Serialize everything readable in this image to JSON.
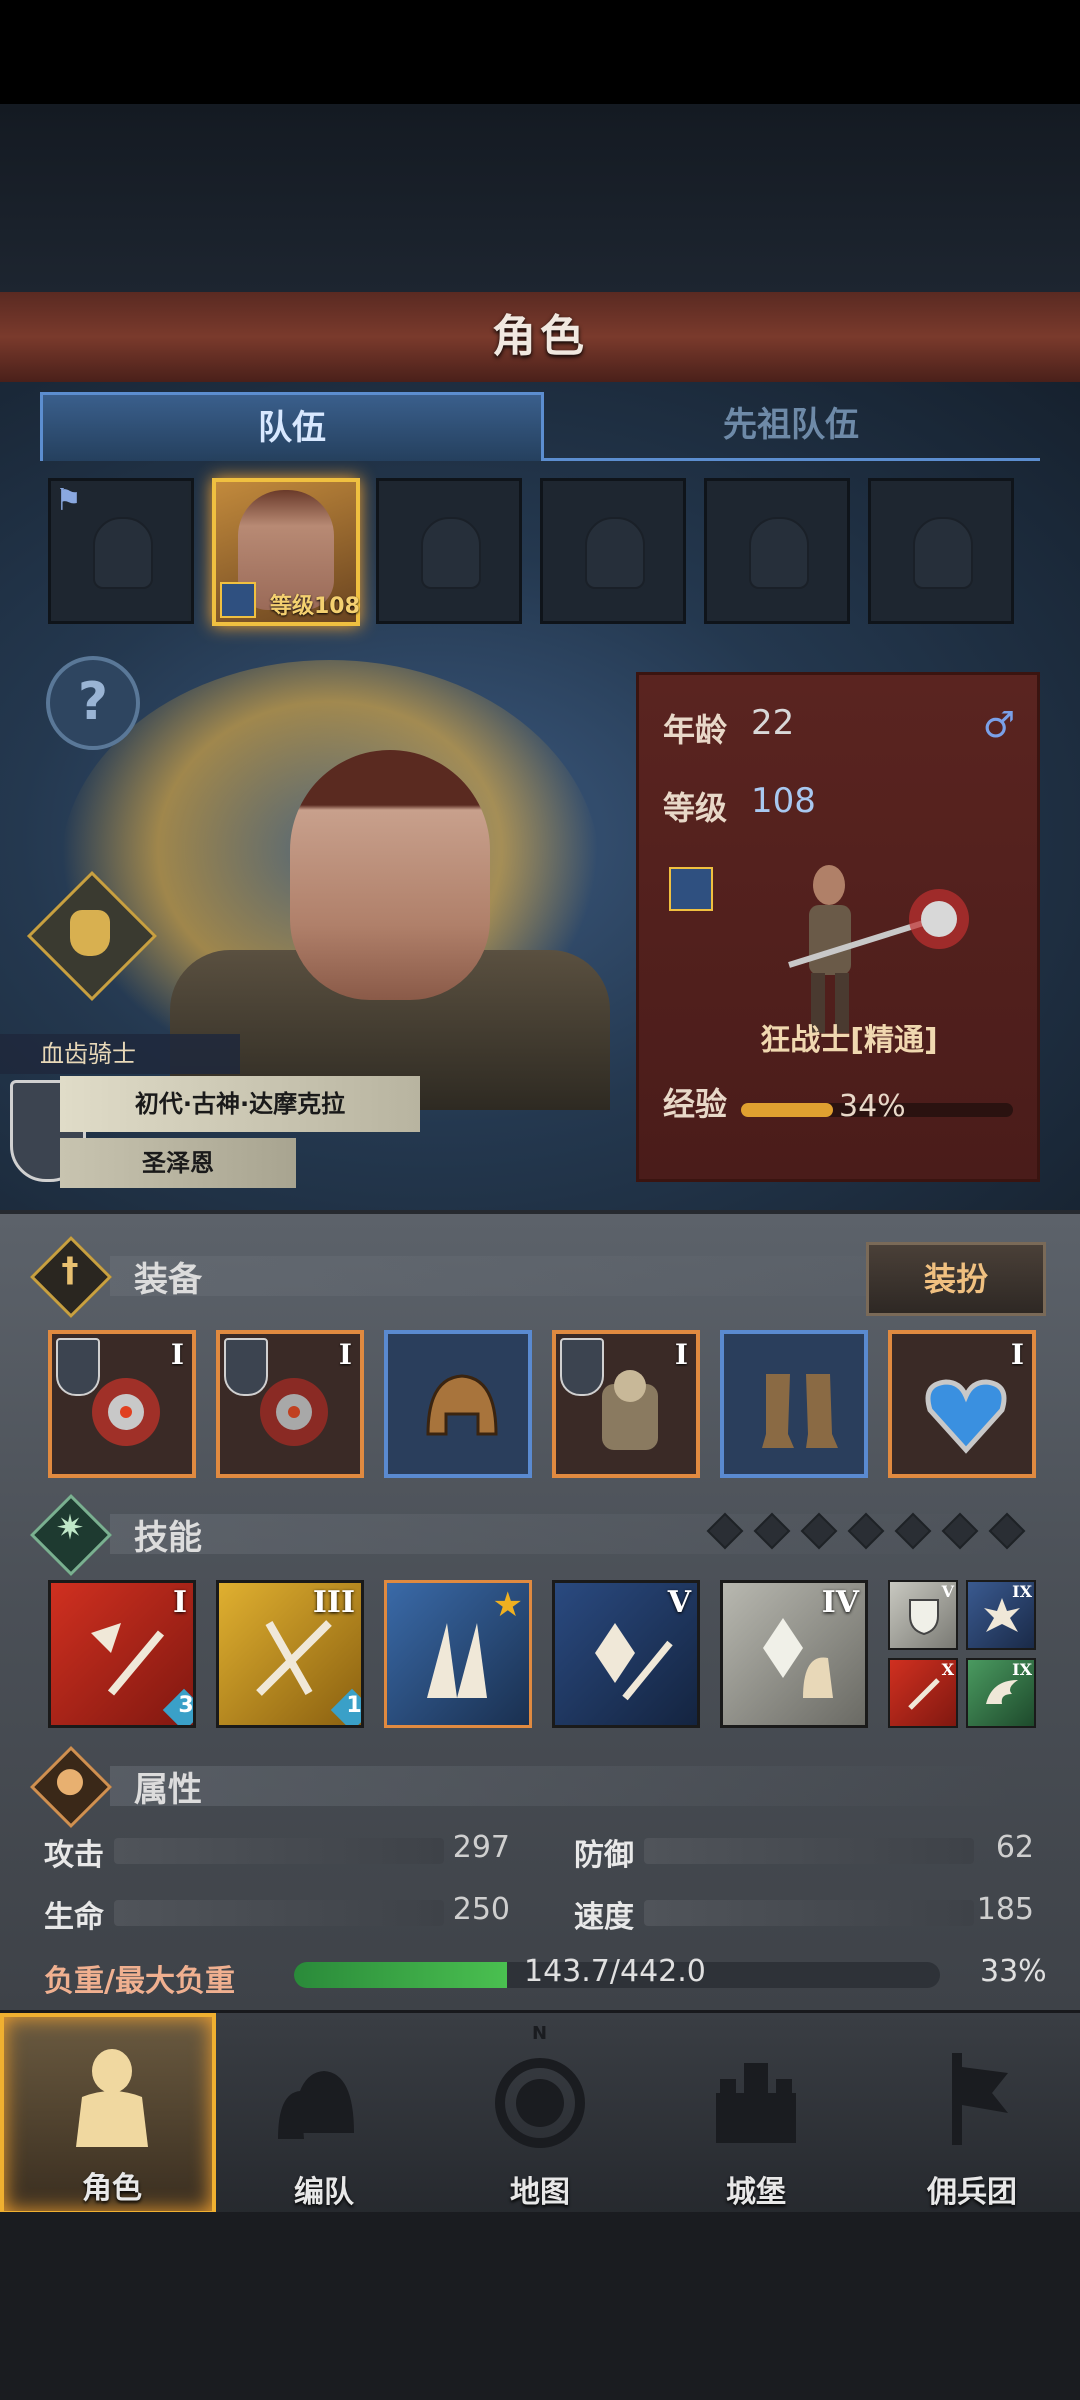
{
  "header": {
    "title": "角色"
  },
  "tabs": [
    {
      "label": "队伍"
    },
    {
      "label": "先祖队伍"
    }
  ],
  "team_slots": {
    "selected_level": "等级108"
  },
  "hero": {
    "faction": "血齿骑士",
    "lineage": "初代·古神·达摩克拉",
    "guild": "圣泽恩"
  },
  "info": {
    "age_label": "年龄",
    "age": "22",
    "gender_icon": "male-icon",
    "gender": "♂",
    "level_label": "等级",
    "level": "108",
    "class_name": "狂战士[精通]",
    "exp_label": "经验",
    "exp_percent": "34%",
    "exp_value": 34
  },
  "equipment": {
    "title": "装备",
    "dress_button": "装扮",
    "items": [
      {
        "icon": "bloody-axe-icon",
        "tier": "I",
        "border": "orange",
        "shield": true
      },
      {
        "icon": "bloody-axe-icon",
        "tier": "I",
        "border": "orange",
        "shield": true
      },
      {
        "icon": "leather-helmet-icon",
        "tier": "",
        "border": "blue",
        "shield": false
      },
      {
        "icon": "fur-armor-icon",
        "tier": "I",
        "border": "orange",
        "shield": true
      },
      {
        "icon": "leather-boots-icon",
        "tier": "",
        "border": "blue",
        "shield": false
      },
      {
        "icon": "heart-amulet-icon",
        "tier": "I",
        "border": "orange",
        "shield": false
      }
    ]
  },
  "skills": {
    "title": "技能",
    "slots_total": 7,
    "items": [
      {
        "icon": "slash-sword-icon",
        "tier": "I",
        "badge": "3",
        "color": "red"
      },
      {
        "icon": "crossed-blades-icon",
        "tier": "III",
        "badge": "1",
        "color": "gold"
      },
      {
        "icon": "claw-strike-icon",
        "tier": "",
        "badge": "",
        "color": "blue",
        "star": true
      },
      {
        "icon": "crystal-sword-icon",
        "tier": "V",
        "badge": "",
        "color": "navy"
      },
      {
        "icon": "crystal-fist-icon",
        "tier": "IV",
        "badge": "",
        "color": "grey"
      }
    ],
    "mini": [
      {
        "icon": "shield-guard-icon",
        "tier": "V"
      },
      {
        "icon": "burst-icon",
        "tier": "IX"
      },
      {
        "icon": "dagger-icon",
        "tier": "X"
      },
      {
        "icon": "wing-icon",
        "tier": "IX"
      }
    ]
  },
  "attributes": {
    "title": "属性",
    "attack_label": "攻击",
    "attack": "297",
    "defense_label": "防御",
    "defense": "62",
    "hp_label": "生命",
    "hp": "250",
    "speed_label": "速度",
    "speed": "185",
    "load_label": "负重/最大负重",
    "load_text": "143.7/442.0",
    "load_percent": "33%",
    "load_value": 33
  },
  "nav": [
    {
      "label": "角色",
      "icon": "knight-icon"
    },
    {
      "label": "编队",
      "icon": "helmet-group-icon"
    },
    {
      "label": "地图",
      "icon": "compass-icon",
      "compass_n": "N"
    },
    {
      "label": "城堡",
      "icon": "castle-icon"
    },
    {
      "label": "佣兵团",
      "icon": "banner-sword-icon"
    }
  ],
  "colors": {
    "accent_gold": "#f0b030",
    "tab_blue": "#5c8ed0",
    "card_red": "#5a2420"
  }
}
